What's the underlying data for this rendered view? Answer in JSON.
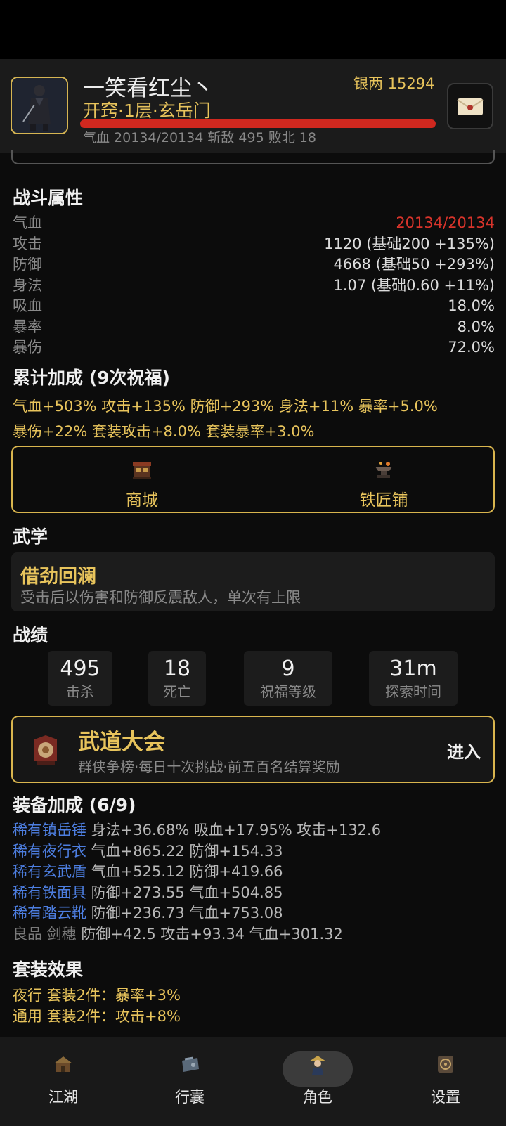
{
  "header": {
    "player_name": "一笑看红尘丶",
    "silver": "银两 15294",
    "realm": "开窍·1层·玄岳门",
    "hp_fraction": 1.0,
    "stats_line": "气血 20134/20134   斩敌 495   败北 18"
  },
  "battle": {
    "title": "战斗属性",
    "rows": [
      {
        "label": "气血",
        "value": "20134/20134"
      },
      {
        "label": "攻击",
        "value": "1120 (基础200 +135%)"
      },
      {
        "label": "防御",
        "value": "4668 (基础50 +293%)"
      },
      {
        "label": "身法",
        "value": "1.07 (基础0.60 +11%)"
      },
      {
        "label": "吸血",
        "value": "18.0%"
      },
      {
        "label": "暴率",
        "value": "8.0%"
      },
      {
        "label": "暴伤",
        "value": "72.0%"
      }
    ]
  },
  "bonus": {
    "title": "累计加成 (9次祝福)",
    "line1": "气血+503%  攻击+135%  防御+293%  身法+11%  暴率+5.0%",
    "line2": "暴伤+22%  套装攻击+8.0%  套装暴率+3.0%"
  },
  "shop": {
    "mall_label": "商城",
    "smith_label": "铁匠铺"
  },
  "martial": {
    "title": "武学",
    "skill_name": "借劲回澜",
    "skill_desc": "受击后以伤害和防御反震敌人，单次有上限"
  },
  "records": {
    "title": "战绩",
    "items": [
      {
        "value": "495",
        "label": "击杀"
      },
      {
        "value": "18",
        "label": "死亡"
      },
      {
        "value": "9",
        "label": "祝福等级"
      },
      {
        "value": "31m",
        "label": "探索时间"
      }
    ]
  },
  "tournament": {
    "title": "武道大会",
    "subtitle": "群侠争榜·每日十次挑战·前五百名结算奖励",
    "enter": "进入"
  },
  "equipment": {
    "title": "装备加成 (6/9)",
    "items": [
      {
        "name": "稀有镇岳锤",
        "stats": " 身法+36.68% 吸血+17.95% 攻击+132.6"
      },
      {
        "name": "稀有夜行衣",
        "stats": " 气血+865.22 防御+154.33"
      },
      {
        "name": "稀有玄武盾",
        "stats": " 气血+525.12 防御+419.66"
      },
      {
        "name": "稀有铁面具",
        "stats": " 防御+273.55 气血+504.85"
      },
      {
        "name": "稀有踏云靴",
        "stats": " 防御+236.73 气血+753.08"
      },
      {
        "name": "良品 剑穗",
        "stats": " 防御+42.5 攻击+93.34 气血+301.32"
      }
    ]
  },
  "sets": {
    "title": "套装效果",
    "line1": "夜行 套装2件：暴率+3%",
    "line2": "通用 套装2件：攻击+8%"
  },
  "nav": {
    "items": [
      {
        "label": "江湖"
      },
      {
        "label": "行囊"
      },
      {
        "label": "角色"
      },
      {
        "label": "设置"
      }
    ],
    "active": "角色"
  },
  "colors": {
    "gold": "#e8c45c",
    "red": "#d8342b",
    "rare_blue": "#4d7ee0"
  }
}
